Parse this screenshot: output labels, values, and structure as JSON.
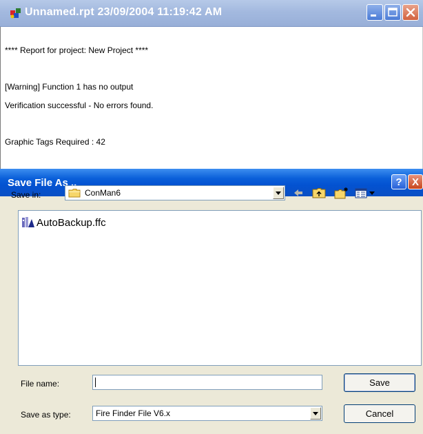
{
  "report_window": {
    "title": "Unnamed.rpt 23/09/2004 11:19:42 AM",
    "lines": [
      "****  Report for project: New Project ****",
      "[Warning] Function 1 has no output",
      "Verification successful - No errors found.",
      "Graphic Tags Required : 42"
    ],
    "icons": {
      "app": "report-app-icon",
      "minimize": "minimize-icon",
      "maximize": "maximize-icon",
      "close": "close-icon"
    }
  },
  "save_dialog": {
    "title": "Save File As ..",
    "save_in_label": "Save in:",
    "folder": "ConMan6",
    "toolbar_icons": [
      "back-arrow-icon",
      "up-folder-icon",
      "new-folder-icon",
      "view-menu-icon"
    ],
    "files": [
      {
        "name": "AutoBackup.ffc",
        "icon": "ffc-file-icon"
      }
    ],
    "file_name_label": "File name:",
    "file_name_value": "",
    "save_as_type_label": "Save as type:",
    "save_as_type_value": "Fire Finder File V6.x",
    "save_button": "Save",
    "cancel_button": "Cancel",
    "help_button": "?",
    "close_button": "X"
  },
  "colors": {
    "dialog_title_blue": "#0a5fd9",
    "inactive_title": "#a3b9df",
    "dialog_face": "#ece9d8",
    "close_red": "#d2623f"
  }
}
